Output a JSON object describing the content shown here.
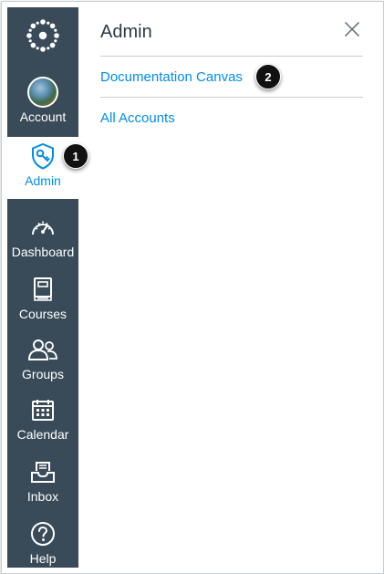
{
  "colors": {
    "rail_background": "#394b58",
    "accent": "#008ee2",
    "title_text": "#2d3b45",
    "divider": "#c7cdd1",
    "callout_background": "#111111"
  },
  "global_nav": {
    "logo_icon": "canvas-logo-icon",
    "items": [
      {
        "label": "Account",
        "icon": "avatar",
        "active": false
      },
      {
        "label": "Admin",
        "icon": "shield-key-icon",
        "active": true
      },
      {
        "label": "Dashboard",
        "icon": "speedometer-icon",
        "active": false
      },
      {
        "label": "Courses",
        "icon": "book-icon",
        "active": false
      },
      {
        "label": "Groups",
        "icon": "people-icon",
        "active": false
      },
      {
        "label": "Calendar",
        "icon": "calendar-icon",
        "active": false
      },
      {
        "label": "Inbox",
        "icon": "inbox-icon",
        "active": false
      },
      {
        "label": "Help",
        "icon": "help-icon",
        "active": false
      }
    ]
  },
  "tray": {
    "title": "Admin",
    "close_icon": "close-icon",
    "links": [
      {
        "label": "Documentation Canvas"
      },
      {
        "label": "All Accounts"
      }
    ]
  },
  "callouts": [
    {
      "number": "1"
    },
    {
      "number": "2"
    }
  ]
}
